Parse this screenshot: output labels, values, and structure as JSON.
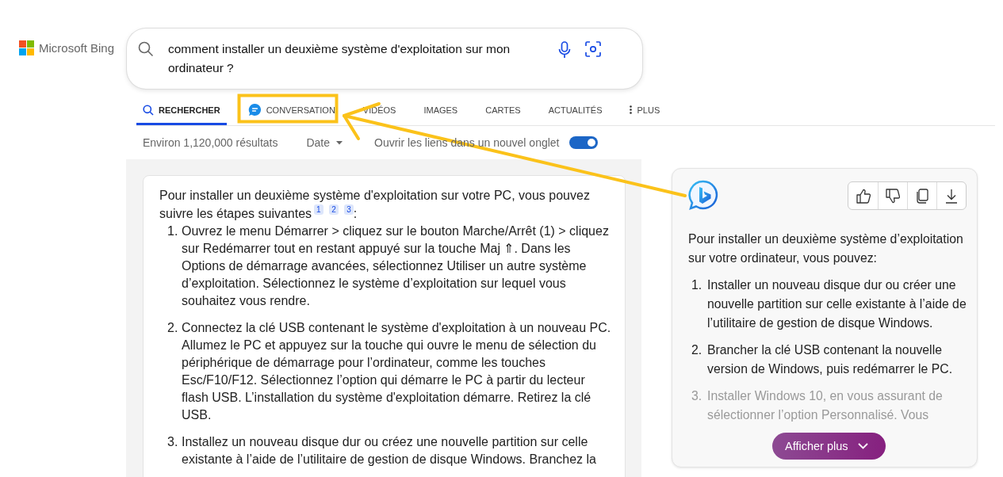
{
  "logo": {
    "text": "Microsoft Bing"
  },
  "search": {
    "value": "comment installer un deuxième système d'exploitation sur mon ordinateur ?"
  },
  "tabs": [
    {
      "label": "RECHERCHER",
      "kind": "search",
      "selected": true
    },
    {
      "label": "CONVERSATION",
      "kind": "chat",
      "selected": false
    },
    {
      "label": "VIDÉOS",
      "kind": "plain",
      "selected": false
    },
    {
      "label": "IMAGES",
      "kind": "plain",
      "selected": false
    },
    {
      "label": "CARTES",
      "kind": "plain",
      "selected": false
    },
    {
      "label": "ACTUALITÉS",
      "kind": "plain",
      "selected": false
    },
    {
      "label": "PLUS",
      "kind": "more",
      "selected": false
    }
  ],
  "results_bar": {
    "count": "Environ 1,120,000 résultats",
    "date_filter": "Date",
    "new_tab_label": "Ouvrir les liens dans un nouvel onglet",
    "new_tab_on": true
  },
  "answer": {
    "intro": "Pour installer un deuxième système d'exploitation sur votre PC, vous pouvez suivre les étapes suivantes$^{1}$ $^{2}$ $^{3}$:",
    "steps": [
      {
        "number": "1.",
        "text": "Ouvrez le menu Démarrer > cliquez sur le bouton Marche/Arrêt (1) > cliquez sur Redémarrer tout en restant appuyé sur la touche Maj ⇑. Dans les Options de démarrage avancées, sélectionnez Utiliser un autre système d’exploitation. Sélectionnez le système d’exploitation sur lequel vous souhaitez vous rendre."
      },
      {
        "number": "2.",
        "text": "Connectez la clé USB contenant le système d'exploitation à un nouveau PC. Allumez le PC et appuyez sur la touche qui ouvre le menu de sélection du périphérique de démarrage pour l’ordinateur, comme les touches Esc/F10/F12. Sélectionnez l’option qui démarre le PC à partir du lecteur flash USB. L’installation du système d'exploitation démarre. Retirez la clé USB."
      },
      {
        "number": "3.",
        "text": "Installez un nouveau disque dur ou créez une nouvelle partition sur celle existante à l’aide de l’utilitaire de gestion de disque Windows. Branchez la"
      }
    ]
  },
  "chat": {
    "intro": "Pour installer un deuxième système d’exploitation sur votre ordinateur, vous pouvez:",
    "steps": [
      {
        "number": "1.",
        "text": "Installer un nouveau disque dur ou créer une nouvelle partition sur celle existante à l’aide de l’utilitaire de gestion de disque Windows.",
        "faded": false
      },
      {
        "number": "2.",
        "text": "Brancher la clé USB contenant la nouvelle version de Windows, puis redémarrer le PC.",
        "faded": false
      },
      {
        "number": "3.",
        "text": "Installer Windows 10, en vous assurant de sélectionner l’option Personnalisé. Vous",
        "faded": true
      }
    ],
    "show_more": "Afficher plus"
  }
}
